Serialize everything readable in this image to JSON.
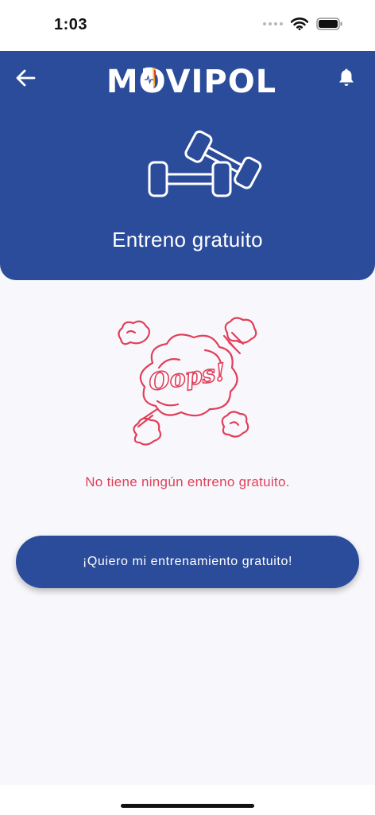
{
  "status_bar": {
    "time": "1:03"
  },
  "header": {
    "logo_text": "MOVIPOL",
    "title": "Entreno gratuito",
    "back_icon": "arrow-left-icon",
    "bell_icon": "bell-icon",
    "dumbbell_icon": "dumbbells-icon",
    "background_color": "#2b4c9b"
  },
  "empty_state": {
    "illustration_text": "Oops!",
    "message": "No tiene ningún entreno gratuito.",
    "accent_color": "#e0405a"
  },
  "cta": {
    "label": "¡Quiero mi entrenamiento gratuito!"
  }
}
